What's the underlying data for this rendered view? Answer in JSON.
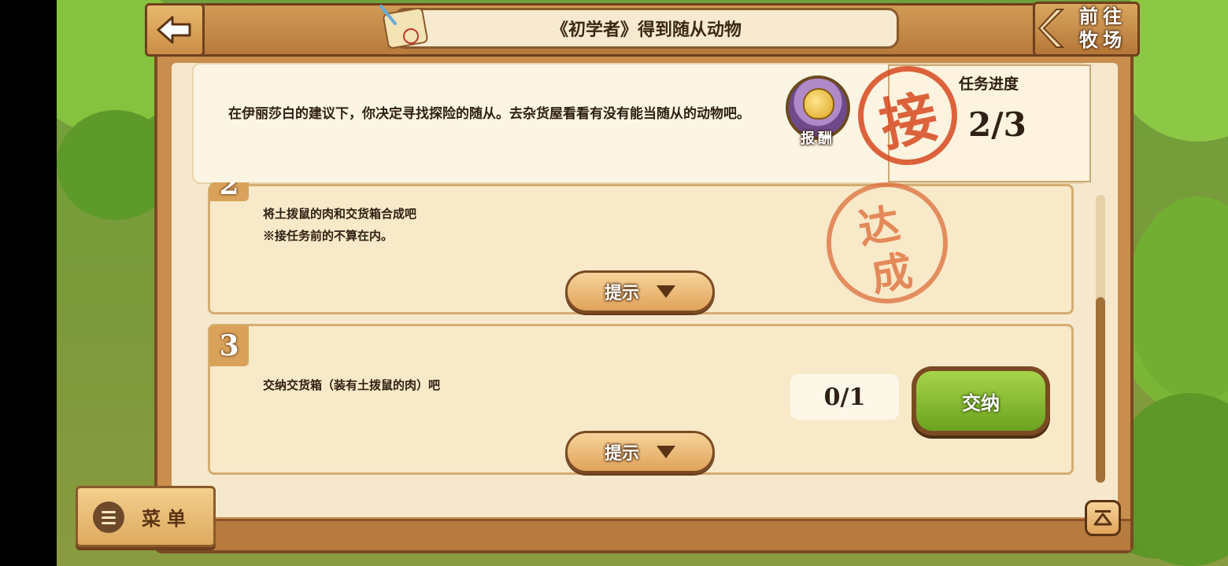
{
  "header": {
    "title": "《初学者》得到随从动物",
    "ranch_line1": "前往",
    "ranch_line2": "牧场"
  },
  "description": {
    "text": "在伊丽莎白的建议下，你决定寻找探险的随从。去杂货屋看看有没有能当随从的动物吧。",
    "reward_label": "报酬",
    "accept_stamp": "接"
  },
  "progress": {
    "label": "任务进度",
    "value": "2/3"
  },
  "steps": [
    {
      "number": "2",
      "line1": "将土拨鼠的肉和交货箱合成吧",
      "line2": "※接任务前的不算在内。",
      "stamp_top": "达",
      "stamp_bottom": "成",
      "hint_label": "提示"
    },
    {
      "number": "3",
      "line1": "交纳交货箱（装有土拨鼠的肉）吧",
      "count": "0/1",
      "submit_label": "交纳",
      "hint_label": "提示"
    }
  ],
  "menu": {
    "label": "菜单"
  },
  "colors": {
    "board_wood": "#c98d4d",
    "panel_cream": "#fdf5e3",
    "stamp_red": "#d64820",
    "submit_green": "#7ab22a"
  },
  "icons": {
    "back": "back-arrow-icon",
    "quest": "quest-scroll-icon",
    "reward": "reward-bag-icon",
    "hint": "triangle-down-icon",
    "menu": "hamburger-icon",
    "scroll_top": "scroll-top-icon"
  }
}
